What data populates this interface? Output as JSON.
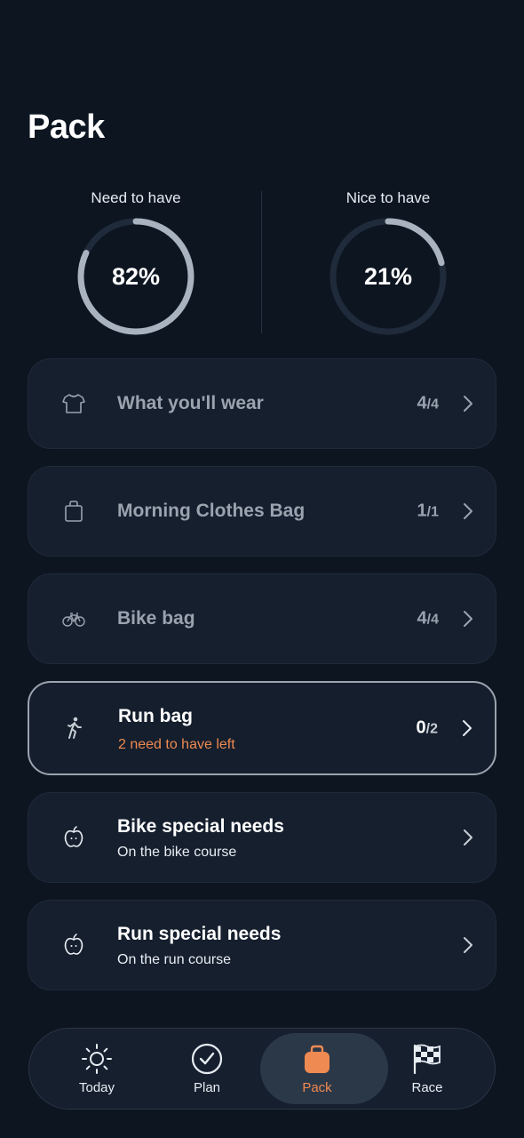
{
  "page": {
    "title": "Pack"
  },
  "progress": [
    {
      "label": "Need to have",
      "percent_text": "82%",
      "fraction": 0.82
    },
    {
      "label": "Nice to have",
      "percent_text": "21%",
      "fraction": 0.21
    }
  ],
  "categories": [
    {
      "name": "What you'll wear",
      "icon": "tshirt-icon",
      "count": "4",
      "total": "/4",
      "subtitle": ""
    },
    {
      "name": "Morning Clothes Bag",
      "icon": "bag-icon",
      "count": "1",
      "total": "/1",
      "subtitle": ""
    },
    {
      "name": "Bike bag",
      "icon": "bicycle-icon",
      "count": "4",
      "total": "/4",
      "subtitle": ""
    },
    {
      "name": "Run bag",
      "icon": "runner-icon",
      "count": "0",
      "total": "/2",
      "subtitle": "2 need to have left"
    },
    {
      "name": "Bike special needs",
      "icon": "apple-icon",
      "count": "",
      "total": "",
      "subtitle": "On the bike course"
    },
    {
      "name": "Run special needs",
      "icon": "apple-icon",
      "count": "",
      "total": "",
      "subtitle": "On the run course"
    }
  ],
  "nav": [
    {
      "label": "Today",
      "icon": "sun-icon"
    },
    {
      "label": "Plan",
      "icon": "check-circle-icon"
    },
    {
      "label": "Pack",
      "icon": "bag-icon"
    },
    {
      "label": "Race",
      "icon": "checkered-flag-icon"
    }
  ],
  "colors": {
    "background": "#0d1521",
    "card": "#151f2e",
    "accent": "#ef8a52",
    "ring_track": "#1f2b3b",
    "ring_fill": "#a9b3bf",
    "muted_text": "#9aa3ae"
  }
}
